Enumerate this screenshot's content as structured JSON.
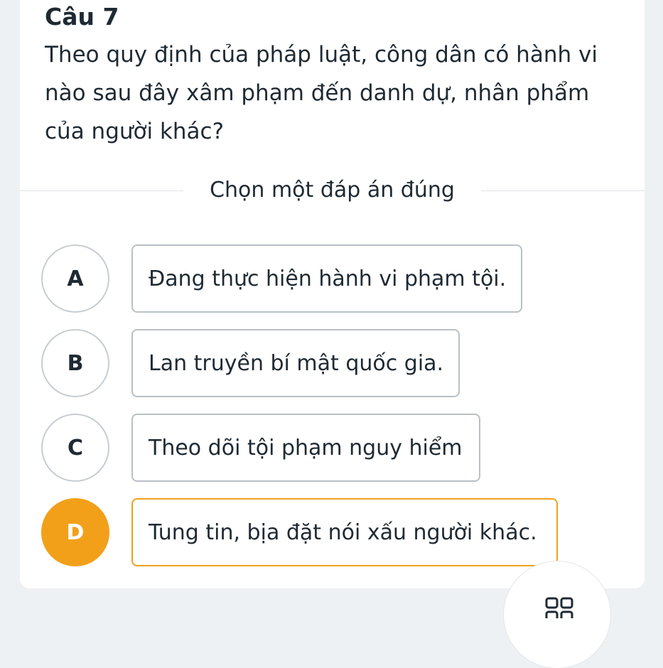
{
  "question": {
    "number_label": "Câu 7",
    "text": "Theo quy định của pháp luật, công dân có hành vi nào sau đây xâm phạm đến danh dự, nhân phẩm của người khác?"
  },
  "instruction": "Chọn một đáp án đúng",
  "options": [
    {
      "letter": "A",
      "text": "Đang thực hiện hành vi phạm tội.",
      "selected": false
    },
    {
      "letter": "B",
      "text": "Lan truyền bí mật quốc gia.",
      "selected": false
    },
    {
      "letter": "C",
      "text": "Theo dõi tội phạm nguy hiểm",
      "selected": false
    },
    {
      "letter": "D",
      "text": "Tung tin, bịa đặt nói xấu người khác.",
      "selected": true
    }
  ],
  "colors": {
    "accent": "#f2a01a",
    "text": "#1f2a33",
    "border": "#b9c0c6",
    "background": "#eef1f3"
  },
  "icons": {
    "fab": "grid-icon"
  }
}
